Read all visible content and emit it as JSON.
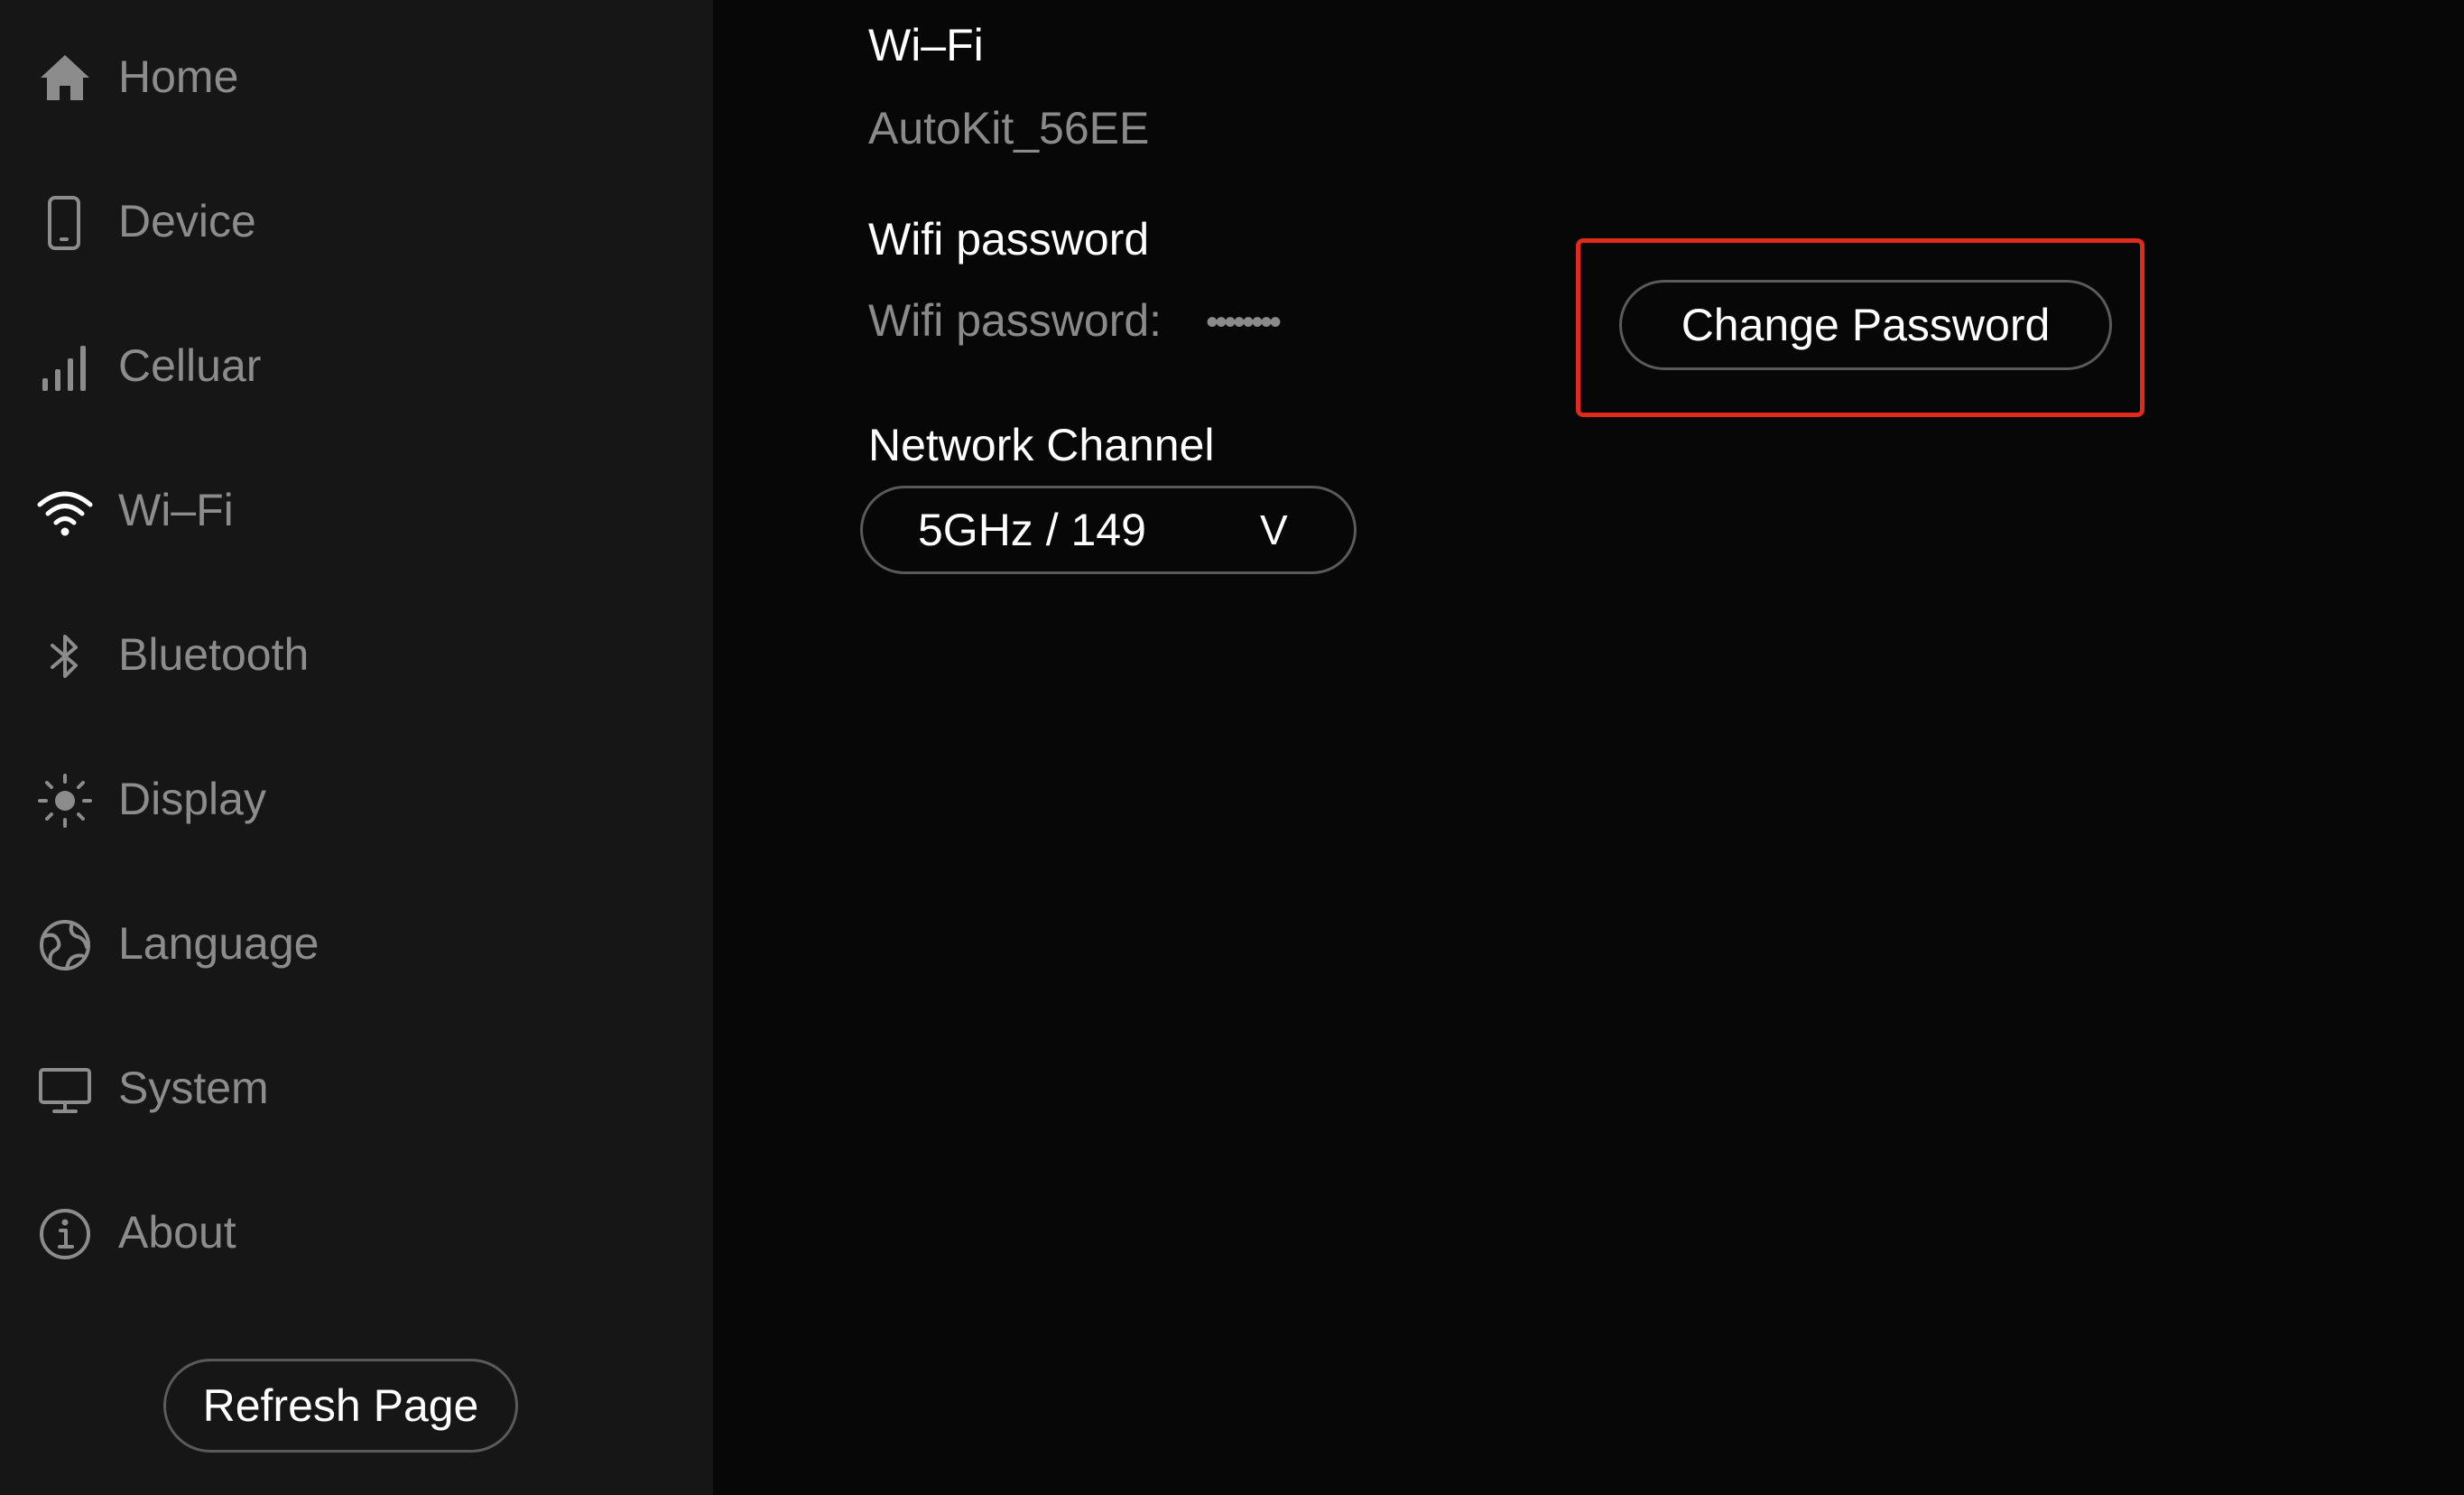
{
  "sidebar": {
    "items": [
      {
        "label": "Home",
        "icon": "home-icon"
      },
      {
        "label": "Device",
        "icon": "phone-icon"
      },
      {
        "label": "Celluar",
        "icon": "signal-bars-icon"
      },
      {
        "label": "Wi–Fi",
        "icon": "wifi-icon"
      },
      {
        "label": "Bluetooth",
        "icon": "bluetooth-icon"
      },
      {
        "label": "Display",
        "icon": "brightness-icon"
      },
      {
        "label": "Language",
        "icon": "globe-icon"
      },
      {
        "label": "System",
        "icon": "monitor-icon"
      },
      {
        "label": "About",
        "icon": "info-icon"
      }
    ],
    "active": "Wi–Fi",
    "refresh_label": "Refresh Page"
  },
  "main": {
    "wifi": {
      "title": "Wi–Fi",
      "ssid": "AutoKit_56EE"
    },
    "password": {
      "title": "Wifi password",
      "label": "Wifi password:",
      "masked_value": "••••••••",
      "change_button": "Change Password"
    },
    "channel": {
      "title": "Network Channel",
      "selected": "5GHz / 149",
      "caret": "V"
    }
  },
  "colors": {
    "sidebar_bg": "#161616",
    "main_bg": "#070707",
    "muted_text": "#8c8c8c",
    "primary_text": "#ffffff",
    "highlight": "#e02a1b"
  }
}
